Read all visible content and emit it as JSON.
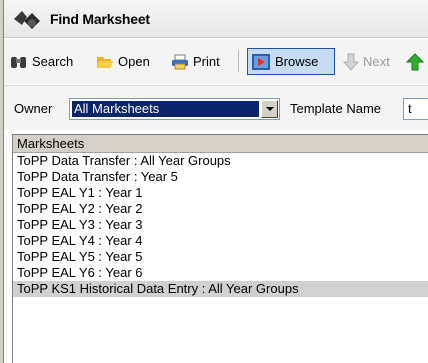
{
  "window": {
    "title": "Find Marksheet"
  },
  "toolbar": {
    "search_label": "Search",
    "open_label": "Open",
    "print_label": "Print",
    "browse_label": "Browse",
    "next_label": "Next"
  },
  "filters": {
    "owner_label": "Owner",
    "owner_value": "All Marksheets",
    "template_label": "Template Name",
    "template_value": "t"
  },
  "list": {
    "header": "Marksheets",
    "items": [
      "ToPP Data Transfer : All Year Groups",
      "ToPP Data Transfer : Year  5",
      "ToPP EAL Y1 : Year  1",
      "ToPP EAL Y2 : Year  2",
      "ToPP EAL Y3 : Year  3",
      "ToPP EAL Y4 : Year  4",
      "ToPP EAL Y5 : Year  5",
      "ToPP EAL Y6 : Year  6",
      "ToPP KS1 Historical Data Entry : All Year Groups"
    ],
    "selected_index": 8
  },
  "icons": {
    "title": "binoculars-icon",
    "search": "binoculars-icon",
    "open": "folder-open-icon",
    "print": "printer-icon",
    "browse": "browse-icon",
    "next": "arrow-down-icon",
    "up": "arrow-up-icon"
  },
  "colors": {
    "selection": "#0a246a",
    "browse_active": "#c6dcf5",
    "up_arrow": "#2fae2f"
  }
}
